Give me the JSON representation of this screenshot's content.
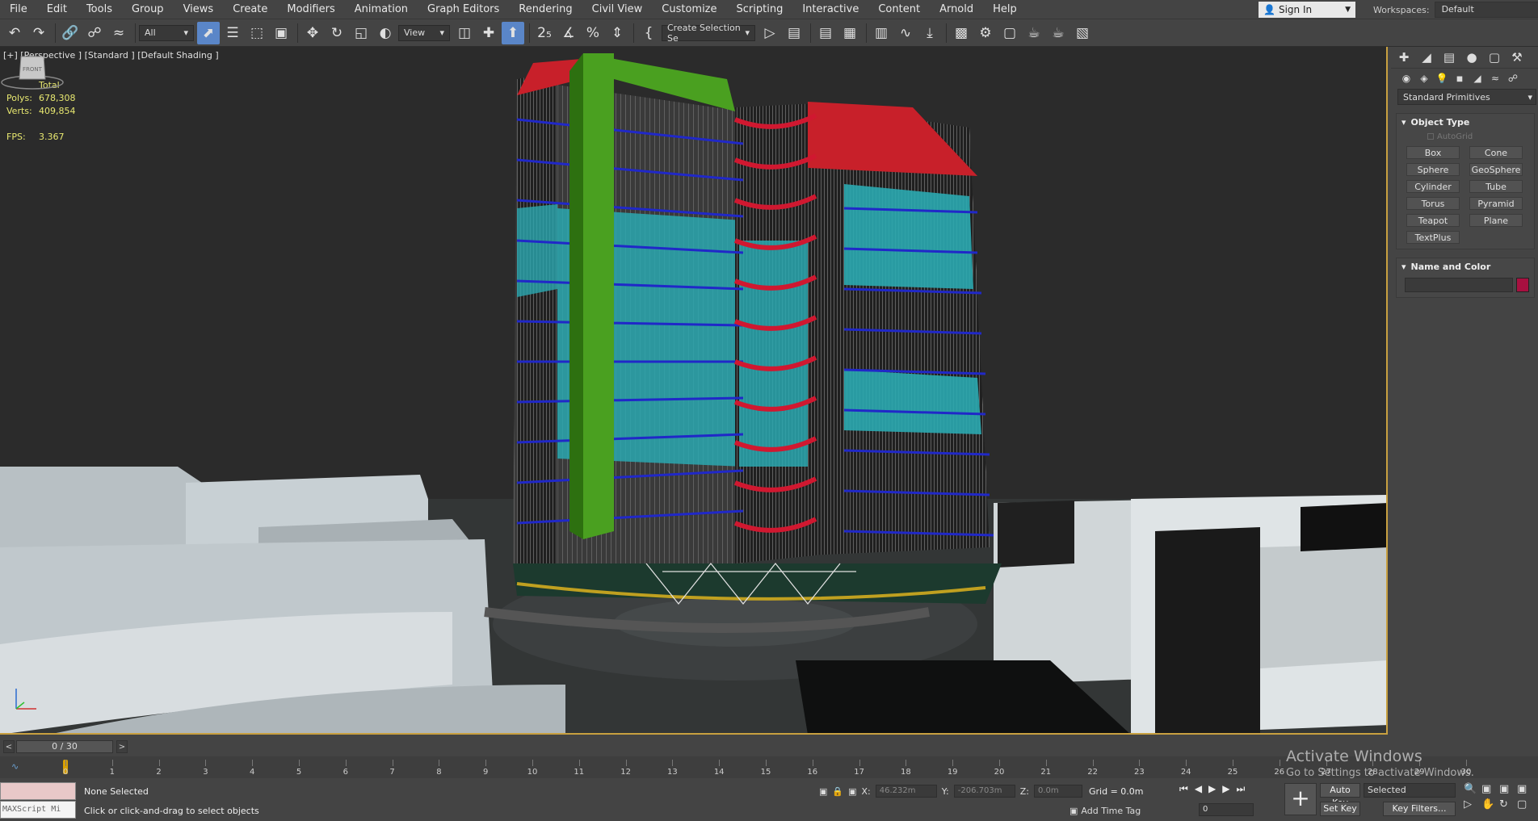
{
  "menu": [
    "File",
    "Edit",
    "Tools",
    "Group",
    "Views",
    "Create",
    "Modifiers",
    "Animation",
    "Graph Editors",
    "Rendering",
    "Civil View",
    "Customize",
    "Scripting",
    "Interactive",
    "Content",
    "Arnold",
    "Help"
  ],
  "account": {
    "sign_in": "Sign In",
    "workspaces_label": "Workspaces:",
    "workspace": "Default"
  },
  "toolbar": {
    "filter": "All",
    "ref_coord": "View",
    "selection_set": "Create Selection Se"
  },
  "viewport": {
    "label": "[+] [Perspective ] [Standard ] [Default Shading ]",
    "stats_total": "Total",
    "polys_label": "Polys:",
    "polys": "678,308",
    "verts_label": "Verts:",
    "verts": "409,854",
    "fps_label": "FPS:",
    "fps": "3.367",
    "viewcube_label": "FRONT"
  },
  "command_panel": {
    "category": "Standard Primitives",
    "object_type_title": "Object Type",
    "autogrid": "AutoGrid",
    "buttons": [
      "Box",
      "Cone",
      "Sphere",
      "GeoSphere",
      "Cylinder",
      "Tube",
      "Torus",
      "Pyramid",
      "Teapot",
      "Plane",
      "TextPlus"
    ],
    "name_color_title": "Name and Color",
    "object_color": "#a81040"
  },
  "time": {
    "slider": "0 / 30",
    "ticks": [
      "0",
      "1",
      "2",
      "3",
      "4",
      "5",
      "6",
      "7",
      "8",
      "9",
      "10",
      "11",
      "12",
      "13",
      "14",
      "15",
      "16",
      "17",
      "18",
      "19",
      "20",
      "21",
      "22",
      "23",
      "24",
      "25",
      "26",
      "27",
      "28",
      "29",
      "30"
    ]
  },
  "status": {
    "maxscript": "MAXScript Mi",
    "selection": "None Selected",
    "prompt": "Click or click-and-drag to select objects",
    "x_label": "X:",
    "x": "46.232m",
    "y_label": "Y:",
    "y": "-206.703m",
    "z_label": "Z:",
    "z": "0.0m",
    "grid": "Grid = 0.0m",
    "add_time_tag": "Add Time Tag",
    "frame": "0",
    "auto_key": "Auto Key",
    "set_key": "Set Key",
    "key_mode": "Selected",
    "key_filters": "Key Filters..."
  },
  "watermark": {
    "title": "Activate Windows",
    "subtitle": "Go to Settings to activate Windows."
  }
}
